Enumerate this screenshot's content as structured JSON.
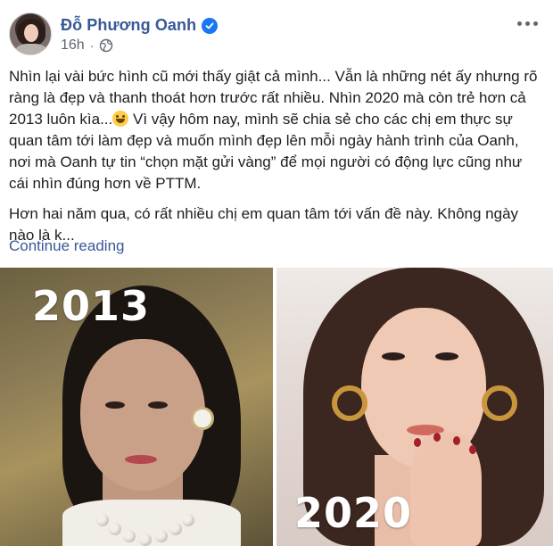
{
  "post": {
    "author": "Đỗ Phương Oanh",
    "verified": true,
    "timestamp": "16h",
    "separator": "·",
    "privacy_icon": "globe-icon",
    "more_icon": "more-options-icon",
    "paragraphs": [
      {
        "before_emoji": "Nhìn lại vài bức hình cũ mới thấy giật cả mình... Vẫn là những nét ấy nhưng rõ ràng là đẹp và thanh thoát hơn trước rất nhiều. Nhìn 2020 mà còn trẻ hơn cả 2013 luôn kìa...",
        "after_emoji": " Vì vậy hôm nay, mình sẽ chia sẻ cho các chị em thực sự quan tâm tới làm đẹp và muốn mình đẹp lên mỗi ngày hành trình của Oanh, nơi mà Oanh tự tin “chọn mặt gửi vàng” để mọi người có động lực cũng như cái nhìn đúng hơn về PTTM."
      },
      {
        "text": "Hơn hai năm qua, có rất nhiều chị em quan tâm tới vấn đề này. Không ngày nào là k..."
      }
    ],
    "continue_label": "Continue reading",
    "photos": [
      {
        "year": "2013"
      },
      {
        "year": "2020"
      }
    ]
  },
  "colors": {
    "name": "#385898",
    "verified": "#1877f2",
    "meta": "#606770",
    "text": "#1c1e21"
  }
}
